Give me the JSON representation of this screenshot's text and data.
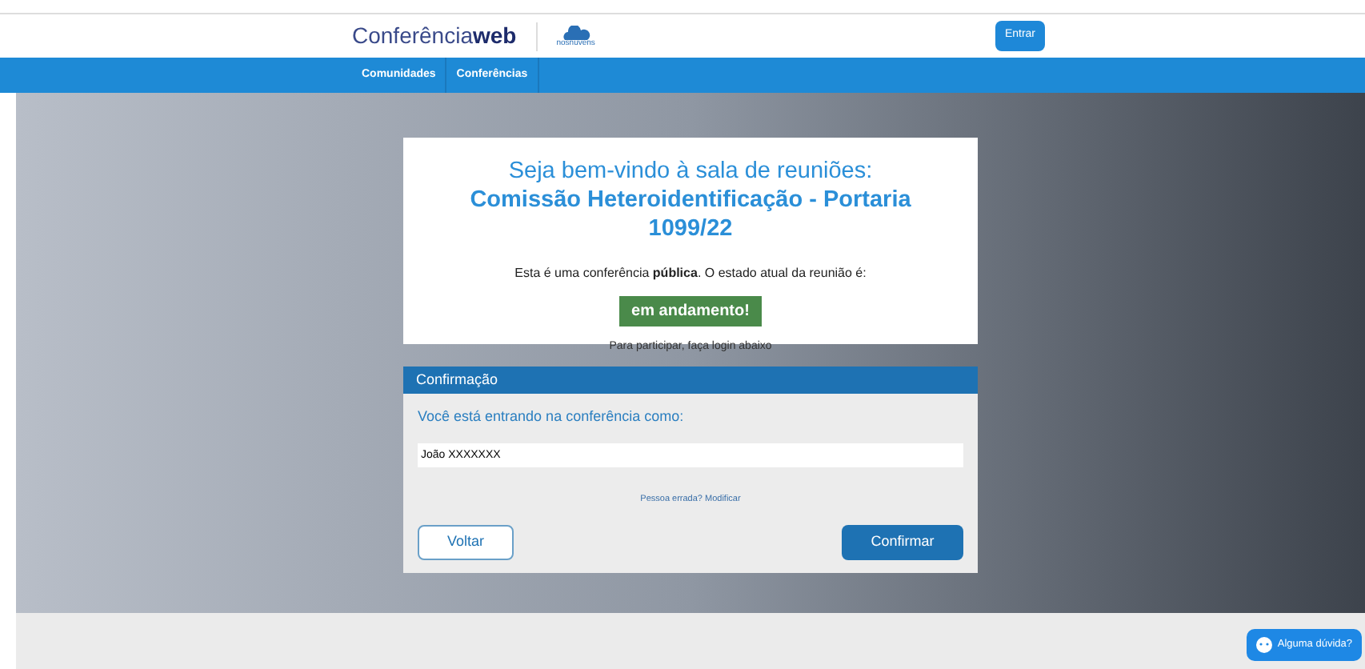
{
  "header": {
    "logo_text": "Conferência",
    "logo_bold": "web",
    "partner": "nosnuvens",
    "login_button": "Entrar"
  },
  "nav": [
    {
      "label": "Comunidades"
    },
    {
      "label": "Conferências"
    }
  ],
  "welcome": {
    "title": "Seja bem-vindo à sala de reuniões: **Comissão Heteroidentificação - Portaria 1099/22**",
    "status_text": "Esta é uma conferência **pública**. O estado atual da reunião é:",
    "status": "em andamento!",
    "hint": "Para participar, faça login abaixo"
  },
  "confirmation": {
    "title": "Confirmação",
    "prompt": "Você está entrando na conferência como:",
    "name": "João XXXXXXX",
    "change_link": "Pessoa errada? Modificar",
    "back_button": "Voltar",
    "confirm_button": "Confirmar"
  },
  "help_button": "Alguma dúvida?"
}
